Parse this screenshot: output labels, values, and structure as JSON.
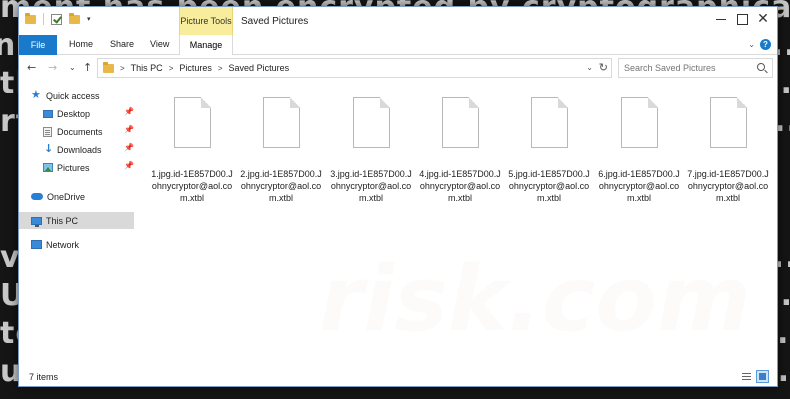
{
  "window": {
    "title": "Saved Pictures",
    "contextual_tab_group": "Picture Tools",
    "controls": {
      "minimize": "–",
      "maximize": "□",
      "close": "✕"
    }
  },
  "ribbon": {
    "tabs": [
      "File",
      "Home",
      "Share",
      "View",
      "Manage"
    ],
    "help": "?",
    "expand": "⌄"
  },
  "address_bar": {
    "breadcrumb": [
      "This PC",
      "Pictures",
      "Saved Pictures"
    ],
    "separator": ">",
    "refresh": "↻",
    "dropdown": "⌄"
  },
  "nav_buttons": {
    "back": "←",
    "forward": "→",
    "recent": "⌄",
    "up": "↑"
  },
  "search": {
    "placeholder": "Search Saved Pictures"
  },
  "nav_pane": {
    "quick_access": "Quick access",
    "items": [
      {
        "label": "Desktop",
        "icon": "desktop-icon",
        "pinned": true
      },
      {
        "label": "Documents",
        "icon": "documents-icon",
        "pinned": true
      },
      {
        "label": "Downloads",
        "icon": "downloads-icon",
        "pinned": true
      },
      {
        "label": "Pictures",
        "icon": "pictures-icon",
        "pinned": true
      }
    ],
    "onedrive": "OneDrive",
    "this_pc": "This PC",
    "network": "Network",
    "pin_glyph": "📌",
    "expander": ">"
  },
  "files": [
    {
      "name": "1.jpg.id-1E857D00.Johnycryptor@aol.com.xtbl"
    },
    {
      "name": "2.jpg.id-1E857D00.Johnycryptor@aol.com.xtbl"
    },
    {
      "name": "3.jpg.id-1E857D00.Johnycryptor@aol.com.xtbl"
    },
    {
      "name": "4.jpg.id-1E857D00.Johnycryptor@aol.com.xtbl"
    },
    {
      "name": "5.jpg.id-1E857D00.Johnycryptor@aol.com.xtbl"
    },
    {
      "name": "6.jpg.id-1E857D00.Johnycryptor@aol.com.xtbl"
    },
    {
      "name": "7.jpg.id-1E857D00.Johnycryptor@aol.com.xtbl"
    }
  ],
  "status_bar": {
    "item_count": "7 items"
  },
  "watermark": "risk.com",
  "colors": {
    "accent": "#1979ca",
    "picture_tools": "#f8ed9d",
    "selected_nav": "#d9d9d9"
  }
}
